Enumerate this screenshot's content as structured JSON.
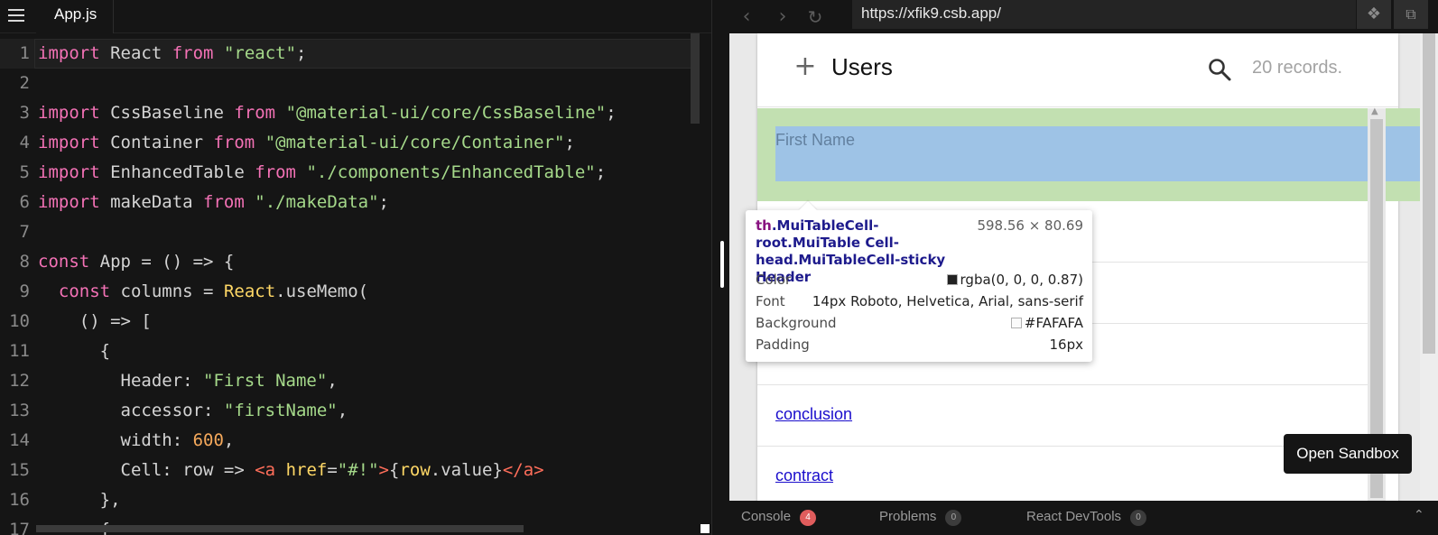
{
  "editor": {
    "file_tab": "App.js",
    "lines": [
      {
        "n": "1",
        "tokens": [
          {
            "c": "k",
            "t": "import"
          },
          {
            "c": "p",
            "t": " React "
          },
          {
            "c": "k",
            "t": "from"
          },
          {
            "c": "p",
            "t": " "
          },
          {
            "c": "s",
            "t": "\"react\""
          },
          {
            "c": "p",
            "t": ";"
          }
        ]
      },
      {
        "n": "2",
        "tokens": []
      },
      {
        "n": "3",
        "tokens": [
          {
            "c": "k",
            "t": "import"
          },
          {
            "c": "p",
            "t": " CssBaseline "
          },
          {
            "c": "k",
            "t": "from"
          },
          {
            "c": "p",
            "t": " "
          },
          {
            "c": "s",
            "t": "\"@material-ui/core/CssBaseline\""
          },
          {
            "c": "p",
            "t": ";"
          }
        ]
      },
      {
        "n": "4",
        "tokens": [
          {
            "c": "k",
            "t": "import"
          },
          {
            "c": "p",
            "t": " Container "
          },
          {
            "c": "k",
            "t": "from"
          },
          {
            "c": "p",
            "t": " "
          },
          {
            "c": "s",
            "t": "\"@material-ui/core/Container\""
          },
          {
            "c": "p",
            "t": ";"
          }
        ]
      },
      {
        "n": "5",
        "tokens": [
          {
            "c": "k",
            "t": "import"
          },
          {
            "c": "p",
            "t": " EnhancedTable "
          },
          {
            "c": "k",
            "t": "from"
          },
          {
            "c": "p",
            "t": " "
          },
          {
            "c": "s",
            "t": "\"./components/EnhancedTable\""
          },
          {
            "c": "p",
            "t": ";"
          }
        ]
      },
      {
        "n": "6",
        "tokens": [
          {
            "c": "k",
            "t": "import"
          },
          {
            "c": "p",
            "t": " makeData "
          },
          {
            "c": "k",
            "t": "from"
          },
          {
            "c": "p",
            "t": " "
          },
          {
            "c": "s",
            "t": "\"./makeData\""
          },
          {
            "c": "p",
            "t": ";"
          }
        ]
      },
      {
        "n": "7",
        "tokens": []
      },
      {
        "n": "8",
        "tokens": [
          {
            "c": "k",
            "t": "const"
          },
          {
            "c": "p",
            "t": " App = () => {"
          }
        ]
      },
      {
        "n": "9",
        "tokens": [
          {
            "c": "p",
            "t": "  "
          },
          {
            "c": "k",
            "t": "const"
          },
          {
            "c": "p",
            "t": " columns = "
          },
          {
            "c": "y",
            "t": "React"
          },
          {
            "c": "p",
            "t": ".useMemo("
          }
        ]
      },
      {
        "n": "10",
        "tokens": [
          {
            "c": "p",
            "t": "    () => ["
          }
        ]
      },
      {
        "n": "11",
        "tokens": [
          {
            "c": "p",
            "t": "      {"
          }
        ]
      },
      {
        "n": "12",
        "tokens": [
          {
            "c": "p",
            "t": "        Header: "
          },
          {
            "c": "s",
            "t": "\"First Name\""
          },
          {
            "c": "p",
            "t": ","
          }
        ]
      },
      {
        "n": "13",
        "tokens": [
          {
            "c": "p",
            "t": "        accessor: "
          },
          {
            "c": "s",
            "t": "\"firstName\""
          },
          {
            "c": "p",
            "t": ","
          }
        ]
      },
      {
        "n": "14",
        "tokens": [
          {
            "c": "p",
            "t": "        width: "
          },
          {
            "c": "n",
            "t": "600"
          },
          {
            "c": "p",
            "t": ","
          }
        ]
      },
      {
        "n": "15",
        "tokens": [
          {
            "c": "p",
            "t": "        Cell: row => "
          },
          {
            "c": "o",
            "t": "<a"
          },
          {
            "c": "p",
            "t": " "
          },
          {
            "c": "y",
            "t": "href"
          },
          {
            "c": "p",
            "t": "="
          },
          {
            "c": "s",
            "t": "\"#!\""
          },
          {
            "c": "o",
            "t": ">"
          },
          {
            "c": "p",
            "t": "{"
          },
          {
            "c": "y",
            "t": "row"
          },
          {
            "c": "p",
            "t": ".value}"
          },
          {
            "c": "o",
            "t": "</a>"
          }
        ]
      },
      {
        "n": "16",
        "tokens": [
          {
            "c": "p",
            "t": "      },"
          }
        ]
      },
      {
        "n": "17",
        "tokens": [
          {
            "c": "p",
            "t": "      {"
          }
        ]
      }
    ]
  },
  "browser": {
    "url": "https://xfik9.csb.app/",
    "app": {
      "title": "Users",
      "records": "20 records.",
      "header_cell": "First Name",
      "rows": [
        "conclusion",
        "contract"
      ]
    },
    "tooltip": {
      "tag": "th",
      "classes": ".MuiTableCell-root.MuiTable Cell-head.MuiTableCell-sticky Header",
      "size": "598.56 × 80.69",
      "props": [
        {
          "key": "Color",
          "value": "rgba(0, 0, 0, 0.87)",
          "swatch": "#222222"
        },
        {
          "key": "Font",
          "value": "14px Roboto, Helvetica, Arial, sans-serif"
        },
        {
          "key": "Background",
          "value": "#FAFAFA",
          "swatch": "#FAFAFA"
        },
        {
          "key": "Padding",
          "value": "16px"
        }
      ]
    },
    "open_sandbox": "Open Sandbox"
  },
  "bottom_panel": {
    "tabs": [
      {
        "label": "Console",
        "badge": "4",
        "style": "red"
      },
      {
        "label": "Problems",
        "badge": "0",
        "style": "grey"
      },
      {
        "label": "React DevTools",
        "badge": "0",
        "style": "grey"
      }
    ]
  },
  "colors": {
    "editor_bg": "#151515",
    "keyword": "#f472b6",
    "string": "#a5d98a",
    "number": "#f4a85b",
    "link": "#1a0dcc",
    "highlight_margin": "#c2e0b1",
    "highlight_content": "#9ec3e6"
  }
}
